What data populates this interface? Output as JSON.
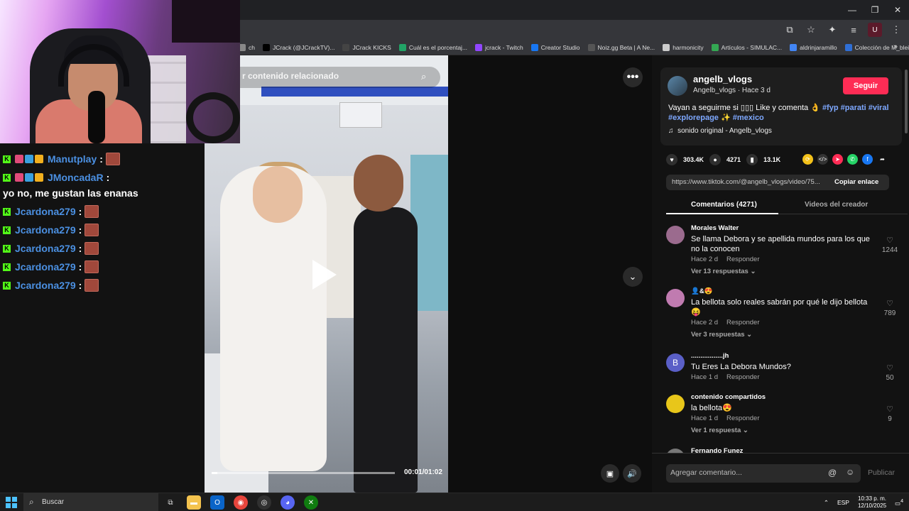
{
  "browser": {
    "window_controls": {
      "minimize": "—",
      "restore": "❐",
      "close": "✕"
    },
    "bookmarks": [
      {
        "label": "ch",
        "color": "#888888"
      },
      {
        "label": "JCrack (@JCrackTV)...",
        "color": "#000000"
      },
      {
        "label": "JCrack KICKS",
        "color": "#444444"
      },
      {
        "label": "Cuál es el porcentaj...",
        "color": "#21a366"
      },
      {
        "label": "jcrack - Twitch",
        "color": "#9146ff"
      },
      {
        "label": "Creator Studio",
        "color": "#1877f2"
      },
      {
        "label": "Noiz.gg Beta | A Ne...",
        "color": "#555555"
      },
      {
        "label": "harmonicity",
        "color": "#cccccc"
      },
      {
        "label": "Artículos - SIMULAC...",
        "color": "#34a853"
      },
      {
        "label": "aldrinjaramillo",
        "color": "#4285f4"
      },
      {
        "label": "Colección de M_blei...",
        "color": "#2f6fd6"
      }
    ],
    "more_bookmarks": "»"
  },
  "chat": {
    "lines": [
      {
        "user": "Manutplay",
        "message": "",
        "emote": true
      },
      {
        "user": "Manutplay",
        "message": "",
        "emote": true
      },
      {
        "user": "JMoncadaR",
        "message": "yo no, me gustan las enanas",
        "emote": false
      },
      {
        "user": "Jcardona279",
        "message": "",
        "emote": true
      },
      {
        "user": "Jcardona279",
        "message": "",
        "emote": true
      },
      {
        "user": "Jcardona279",
        "message": "",
        "emote": true
      },
      {
        "user": "Jcardona279",
        "message": "",
        "emote": true
      },
      {
        "user": "Jcardona279",
        "message": "",
        "emote": true
      }
    ]
  },
  "video": {
    "search_placeholder": "r contenido relacionado",
    "time": "00:01/01:02",
    "progress": 0.03
  },
  "post": {
    "username": "angelb_vlogs",
    "subtitle": "Angelb_vlogs · Hace 3 d",
    "follow": "Seguir",
    "description_text": "Vayan a seguirme si ",
    "description_rest": " Like y comenta 👌",
    "hashtags": [
      "#fyp",
      "#parati",
      "#viral",
      "#explorepage",
      "#mexico"
    ],
    "sound": "sonido original - Angelb_vlogs",
    "likes": "303.4K",
    "comments": "4271",
    "saves": "13.1K",
    "link": "https://www.tiktok.com/@angelb_vlogs/video/75...",
    "copy_link": "Copiar enlace",
    "tab_comments": "Comentarios (4271)",
    "tab_creator": "Videos del creador"
  },
  "comments": [
    {
      "user": "Morales Walter",
      "text": "Se llama Debora y se apellida mundos para los que no la conocen",
      "time": "Hace 2 d",
      "reply": "Responder",
      "replies": "Ver 13 respuestas ⌄",
      "likes": "1244",
      "color": "#9b6b8e"
    },
    {
      "user": "👤&😍",
      "text": "La bellota solo reales sabrán por qué le dijo bellota 😝",
      "time": "Hace 2 d",
      "reply": "Responder",
      "replies": "Ver 3 respuestas ⌄",
      "likes": "789",
      "color": "#c07bb0"
    },
    {
      "user": ".................jh",
      "text": "Tu Eres La Debora Mundos?",
      "time": "Hace 1 d",
      "reply": "Responder",
      "replies": "",
      "likes": "50",
      "color": "#5a5fc7",
      "initial": "B"
    },
    {
      "user": "contenido compartidos",
      "text": "la bellota😍",
      "time": "Hace 1 d",
      "reply": "Responder",
      "replies": "Ver 1 respuesta ⌄",
      "likes": "9",
      "color": "#e8c61a"
    },
    {
      "user": "Fernando Funez",
      "text": "",
      "time": "",
      "reply": "",
      "replies": "",
      "likes": "",
      "color": "#777777"
    }
  ],
  "comment_input": {
    "placeholder": "Agregar comentario...",
    "publish": "Publicar"
  },
  "taskbar": {
    "search": "Buscar",
    "language": "ESP",
    "time": "10:33 p. m.",
    "date": "12/10/2025",
    "notifications": "4"
  }
}
